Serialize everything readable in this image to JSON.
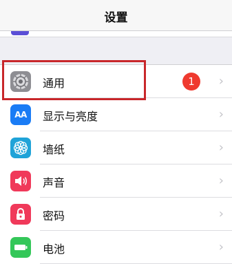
{
  "nav": {
    "title": "设置"
  },
  "settings": {
    "items": [
      {
        "label": "通用",
        "icon": "gear-icon",
        "icon_color": "#8e8e93",
        "badge": "1"
      },
      {
        "label": "显示与亮度",
        "icon": "display-brightness-icon",
        "icon_color": "#1a7cf5",
        "icon_text": "AA"
      },
      {
        "label": "墙纸",
        "icon": "wallpaper-flower-icon",
        "icon_color": "#1fa3d8"
      },
      {
        "label": "声音",
        "icon": "speaker-icon",
        "icon_color": "#f0395a"
      },
      {
        "label": "密码",
        "icon": "lock-icon",
        "icon_color": "#f0395a"
      },
      {
        "label": "电池",
        "icon": "battery-icon",
        "icon_color": "#34c759"
      }
    ],
    "chevron": "›"
  },
  "colors": {
    "background": "#efeff4",
    "highlight": "#c8262a",
    "badge": "#ef3a2f"
  }
}
